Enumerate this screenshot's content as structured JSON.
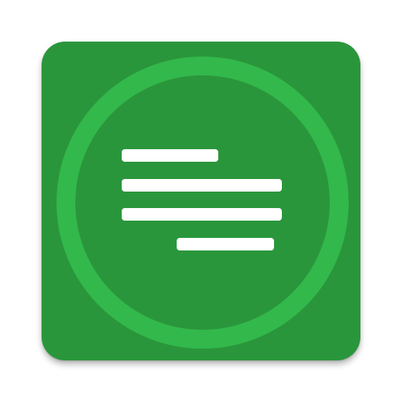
{
  "icon": {
    "semantic": "text-align-lines-icon",
    "colors": {
      "background": "#2A963B",
      "ring": "#33B84B",
      "lines": "#FFFFFF"
    },
    "line_count": 4
  }
}
